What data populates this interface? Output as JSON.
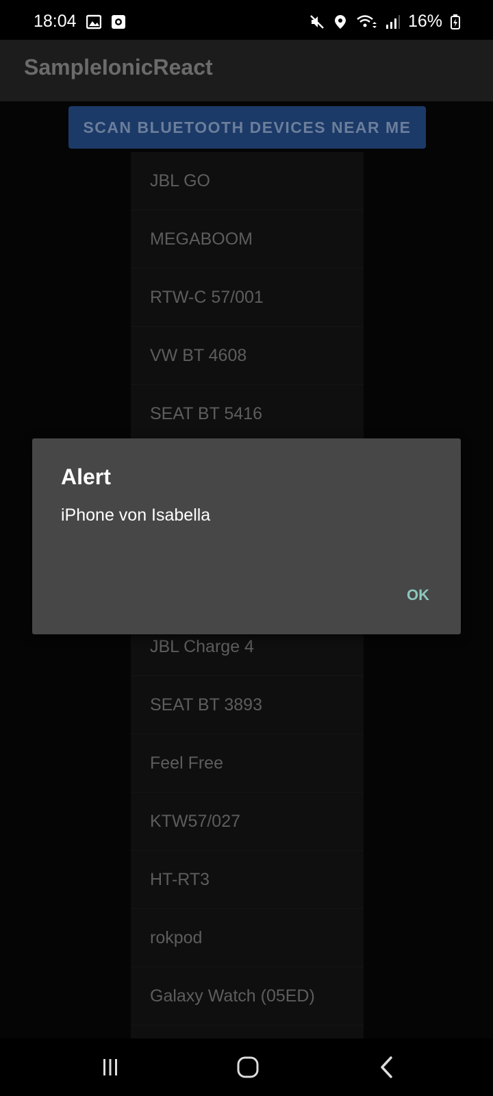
{
  "status_bar": {
    "time": "18:04",
    "battery": "16%",
    "icons_left": [
      "gallery-icon",
      "screen-record-icon"
    ],
    "icons_right": [
      "mute-icon",
      "location-icon",
      "wifi-icon",
      "signal-icon",
      "battery-charging-icon"
    ]
  },
  "app": {
    "title": "SampleIonicReact"
  },
  "scan_button": {
    "label": "SCAN BLUETOOTH DEVICES NEAR ME"
  },
  "devices": [
    "JBL GO",
    "MEGABOOM",
    "RTW-C 57/001",
    "VW BT 4608",
    "SEAT BT 5416",
    "",
    "",
    "",
    "JBL Charge 4",
    "SEAT BT 3893",
    "Feel Free",
    "KTW57/027",
    "HT-RT3",
    "rokpod",
    "Galaxy Watch (05ED)"
  ],
  "dialog": {
    "title": "Alert",
    "message": "iPhone von Isabella",
    "ok_label": "OK"
  },
  "nav": {
    "icons": [
      "recent-apps-icon",
      "home-icon",
      "back-icon"
    ]
  },
  "colors": {
    "scan_button": "#1c3a68",
    "dialog_bg": "#474747",
    "ok_accent": "#8ec6be"
  }
}
